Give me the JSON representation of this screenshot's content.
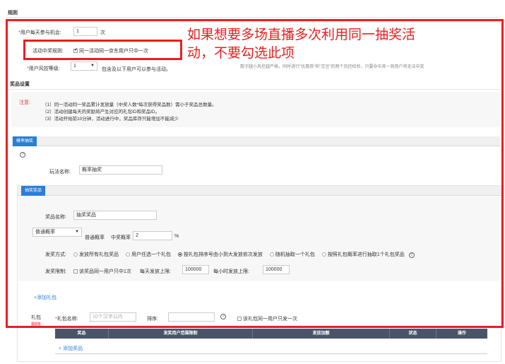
{
  "rules": {
    "title": "规则",
    "daily_chances_label": "用户每天参与机会:",
    "daily_chances_value": "1",
    "daily_chances_unit": "次",
    "activity_rule_label": "活动中奖规则:",
    "activity_rule_option": "同一活动同一京东用户只中一次",
    "risk_label": "用户风控等级:",
    "risk_value": "1",
    "risk_suffix": "包含及以下用户可以参与活动。",
    "risk_note": "数字越小风控越严格，同时进行\"优惠券\"和\"京豆\"的两个风控校验，只要命中其一则用户将无法中奖"
  },
  "annotation": {
    "line1": "如果想要多场直播多次利用同一抽奖活",
    "line2": "动，不要勾选此项"
  },
  "prize_settings": {
    "title": "奖品设置",
    "notice_label": "注意:",
    "notices": [
      "（1）同一活动同一奖品累计发放量（中奖人数*每次获得奖品数）需小于奖品总数量。",
      "（2）活动创建每天的奖励将产生对应的礼包ID和奖品ID。",
      "（3）活动开始前10分钟，活动进行中，奖品库存只能增加不能减少"
    ]
  },
  "prob_section": {
    "tab_label": "概率抽奖",
    "help_icon": "?",
    "play_name_label": "玩法名称:",
    "play_name_value": "概率抽奖"
  },
  "prize_section": {
    "tab_label": "抽奖奖品",
    "prize_name_label": "奖品名称:",
    "prize_name_value": "抽奖奖品",
    "prob_type_value": "普通概率",
    "prob_type_label": "普通概率",
    "win_rate_label": "中奖概率",
    "win_rate_value": "2",
    "win_rate_unit": "%",
    "mode_label": "发奖方式:",
    "modes": [
      {
        "label": "发放所有礼包奖品",
        "selected": false
      },
      {
        "label": "用户任选一个礼包",
        "selected": false
      },
      {
        "label": "按礼包排序号由小到大发放依次发放",
        "selected": true
      },
      {
        "label": "随机抽取一个礼包",
        "selected": false
      },
      {
        "label": "按照礼包概率进行抽取1个礼包奖品",
        "selected": false
      }
    ],
    "limit_label": "发奖限制:",
    "limit_checkbox": "该奖品同一用户只中1次",
    "daily_limit_label": "每天发放上限:",
    "daily_limit_value": "100000",
    "hourly_limit_label": "每小时发放上限:",
    "hourly_limit_value": "100000",
    "add_package_link": "+添加礼包",
    "package_label": "礼包",
    "delete_link": "删除",
    "package_name_label": "礼包名称:",
    "package_name_placeholder": "10个汉字以内",
    "sort_label": "排序:",
    "package_once_checkbox": "该礼包同一用户只发一次",
    "table_headers": [
      "奖品",
      "发奖用户范围限制",
      "发放加额",
      "状态",
      "操作"
    ],
    "add_prize_link": "+ 添加奖品"
  }
}
